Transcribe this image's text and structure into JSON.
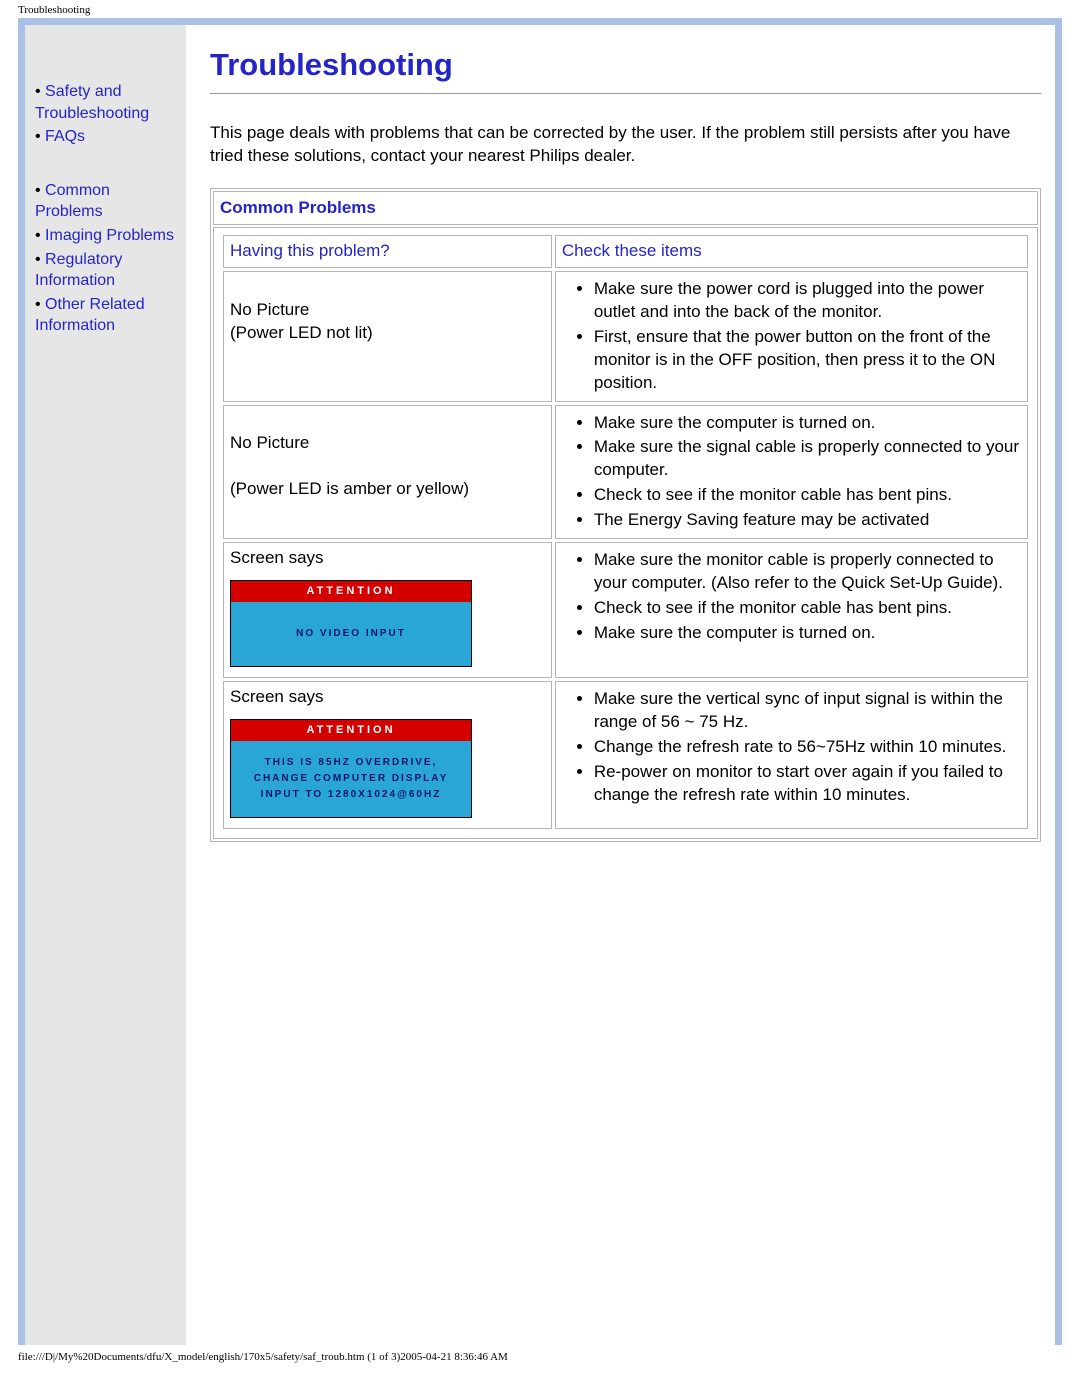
{
  "header_title": "Troubleshooting",
  "sidebar": {
    "items": [
      {
        "label": "Safety and Troubleshooting"
      },
      {
        "label": "FAQs"
      },
      {
        "label": "Common Problems"
      },
      {
        "label": "Imaging Problems"
      },
      {
        "label": "Regulatory Information"
      },
      {
        "label": "Other Related Information"
      }
    ]
  },
  "main": {
    "title": "Troubleshooting",
    "intro": "This page deals with problems that can be corrected by the user. If the problem still persists after you have tried these solutions, contact your nearest Philips dealer.",
    "section_head": "Common Problems",
    "col1_head": "Having this problem?",
    "col2_head": "Check these items",
    "rows": [
      {
        "problem_lines": [
          "No Picture",
          "(Power LED not lit)"
        ],
        "checks": [
          "Make sure the power cord is plugged into the power outlet and into the back of the monitor.",
          "First, ensure that the power button on the front of the monitor is in the OFF position, then press it to the ON position."
        ]
      },
      {
        "problem_lines": [
          "No Picture",
          "",
          "(Power LED is amber or yellow)"
        ],
        "checks": [
          "Make sure the computer is turned on.",
          "Make sure the signal cable is properly connected to your computer.",
          "Check to see if the monitor cable has bent pins.",
          "The Energy Saving feature may be activated"
        ]
      },
      {
        "screen_says": "Screen says",
        "osd": {
          "title": "ATTENTION",
          "body": [
            "NO VIDEO INPUT"
          ]
        },
        "checks": [
          "Make sure the monitor cable is properly connected to your computer. (Also refer to the Quick Set-Up Guide).",
          "Check to see if the monitor cable has bent pins.",
          "Make sure the computer is turned on."
        ]
      },
      {
        "screen_says": "Screen says",
        "osd": {
          "title": "ATTENTION",
          "body": [
            "THIS IS 85HZ OVERDRIVE,",
            "CHANGE COMPUTER DISPLAY",
            "INPUT TO 1280X1024@60HZ"
          ]
        },
        "checks": [
          "Make sure the vertical sync of input signal is within the range of 56 ~ 75 Hz.",
          "Change the refresh rate to 56~75Hz within 10 minutes.",
          "Re-power on monitor to start over again if you failed to change the refresh rate within 10 minutes."
        ]
      }
    ]
  },
  "footer": "file:///D|/My%20Documents/dfu/X_model/english/170x5/safety/saf_troub.htm (1 of 3)2005-04-21 8:36:46 AM"
}
